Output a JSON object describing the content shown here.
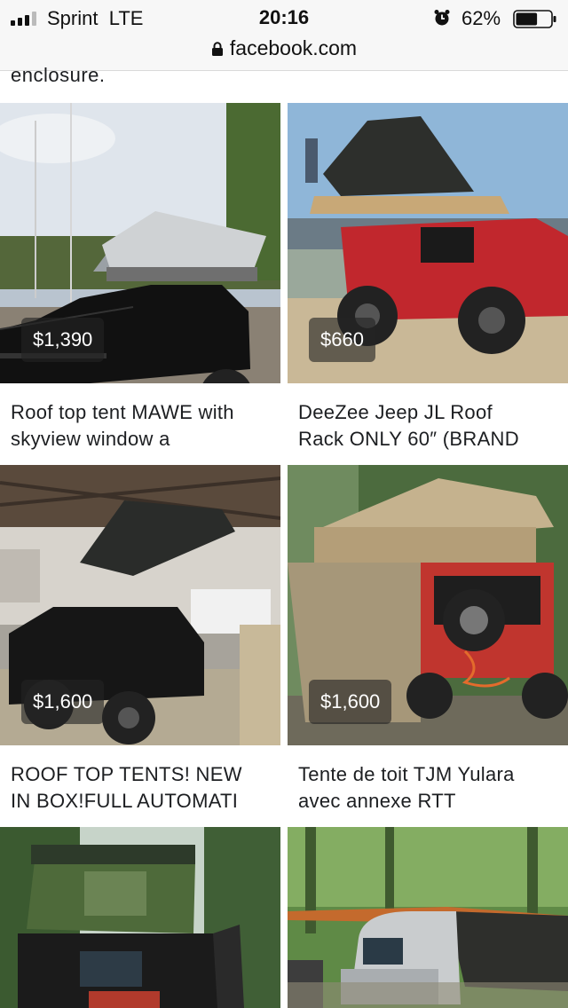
{
  "status_bar": {
    "carrier": "Sprint",
    "network": "LTE",
    "time": "20:16",
    "battery_percent": "62%",
    "battery_level": 0.62,
    "signal_bars": 3
  },
  "browser": {
    "url": "facebook.com"
  },
  "previous_listing_tail": "enclosure.",
  "listings": [
    {
      "price": "$1,390",
      "title_line1": "Roof top tent MAWE with",
      "title_line2": "skyview window a",
      "photo": "black SUV with grey roof top tent"
    },
    {
      "price": "$660",
      "title_line1": "DeeZee Jeep JL Roof",
      "title_line2": "Rack ONLY 60″ (BRAND",
      "photo": "red jeep with black roof top tent"
    },
    {
      "price": "$1,600",
      "title_line1": "ROOF TOP TENTS! NEW",
      "title_line2": "IN BOX!FULL AUTOMATI",
      "photo": "black jeep with hard shell tent in garage"
    },
    {
      "price": "$1,600",
      "title_line1": "Tente de toit TJM Yulara",
      "title_line2": "avec annexe RTT",
      "photo": "jeep with tan tent and annex in forest"
    },
    {
      "price": "",
      "title_line1": "",
      "title_line2": "",
      "photo": "green hard shell tent on vehicle"
    },
    {
      "price": "",
      "title_line1": "",
      "title_line2": "",
      "photo": "teardrop trailer with awning in forest"
    }
  ],
  "colors": {
    "text": "#1c1e21",
    "status_bg": "#f7f7f7",
    "price_badge": "rgba(35,35,35,0.62)"
  }
}
